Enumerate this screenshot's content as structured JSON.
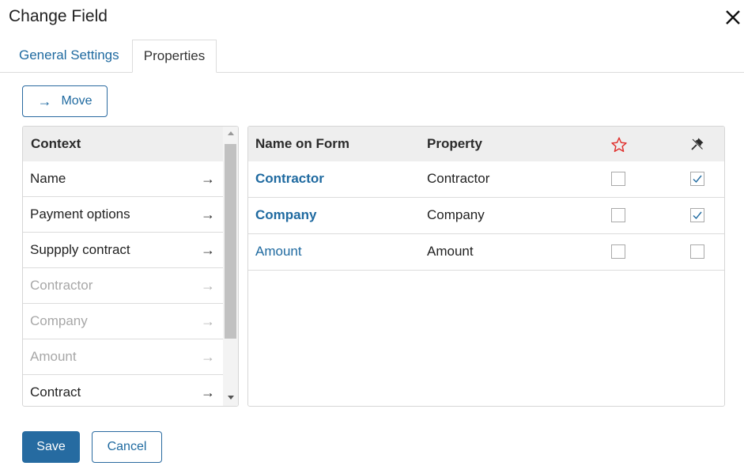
{
  "dialog": {
    "title": "Change Field",
    "close_icon": "close-icon"
  },
  "tabs": [
    {
      "label": "General Settings",
      "active": false
    },
    {
      "label": "Properties",
      "active": true
    }
  ],
  "move_button": {
    "label": "Move",
    "icon": "arrow-right-icon"
  },
  "context": {
    "header": "Context",
    "items": [
      {
        "label": "Name",
        "enabled": true
      },
      {
        "label": "Payment options",
        "enabled": true
      },
      {
        "label": "Suppply contract",
        "enabled": true
      },
      {
        "label": "Contractor",
        "enabled": false
      },
      {
        "label": "Company",
        "enabled": false
      },
      {
        "label": "Amount",
        "enabled": false
      },
      {
        "label": "Contract",
        "enabled": true
      }
    ],
    "arrow_glyph": "→"
  },
  "properties": {
    "headers": {
      "name_on_form": "Name on Form",
      "property": "Property",
      "required_icon": "star-icon",
      "readonly_icon": "pin-icon"
    },
    "rows": [
      {
        "name": "Contractor",
        "property": "Contractor",
        "required": false,
        "readonly": true
      },
      {
        "name": "Company",
        "property": "Company",
        "required": false,
        "readonly": true
      },
      {
        "name": "Amount",
        "property": "Amount",
        "required": false,
        "readonly": false
      }
    ]
  },
  "footer": {
    "save_label": "Save",
    "cancel_label": "Cancel"
  },
  "colors": {
    "accent": "#1f6aa0",
    "save_bg": "#266ba1",
    "star": "#e0312e",
    "disabled_text": "#a7a7a7"
  }
}
